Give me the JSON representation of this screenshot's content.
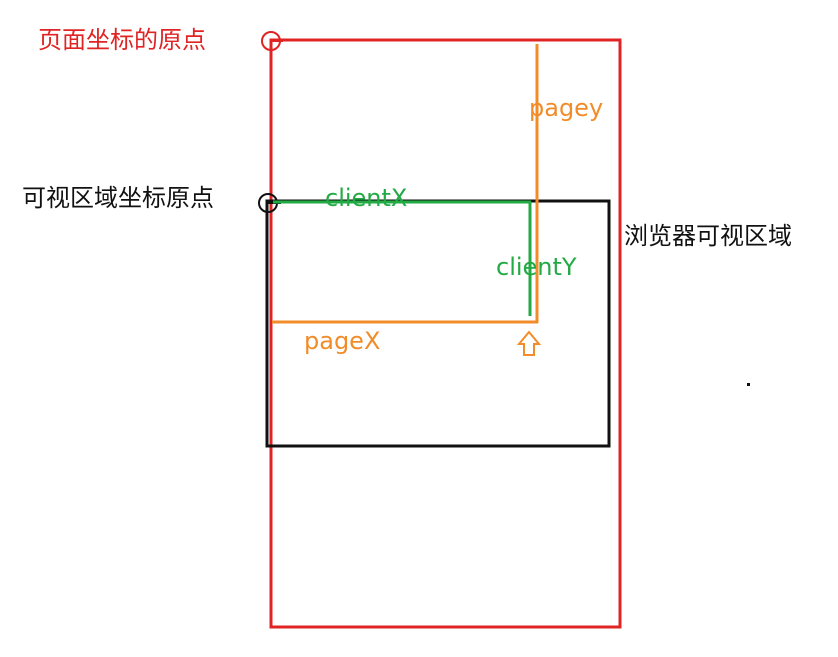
{
  "labels": {
    "page_origin": "页面坐标的原点",
    "viewport_origin": "可视区域坐标原点",
    "viewport": "浏览器可视区域",
    "pagey": "pagey",
    "clientx": "clientX",
    "clienty": "clientY",
    "pagex": "pageX"
  },
  "colors": {
    "page": "#e02424",
    "viewport": "#111111",
    "page_coords": "#f28c28",
    "client_coords": "#22aa44"
  },
  "icons": {
    "pointer": "up-arrow-icon",
    "origin_marker": "circle-marker-icon"
  }
}
